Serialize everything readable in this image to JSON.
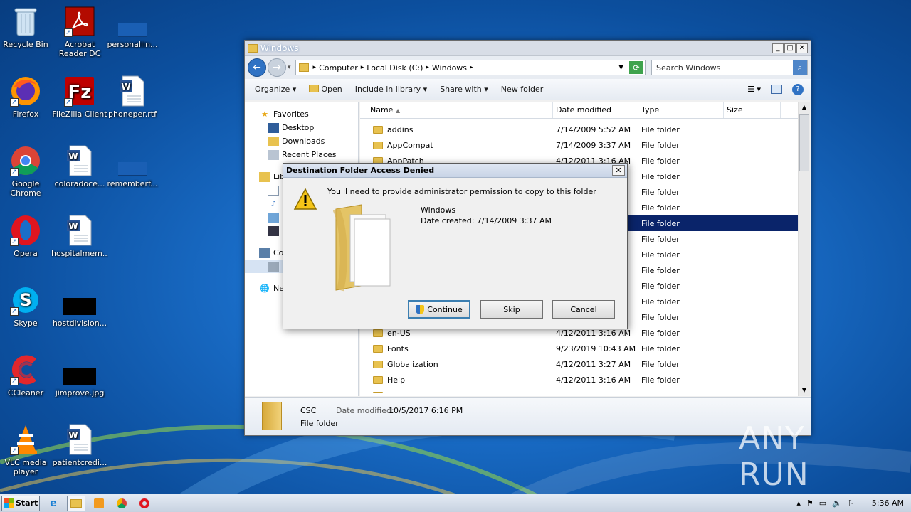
{
  "desktop": {
    "icons": [
      {
        "label": "Recycle Bin"
      },
      {
        "label": "Acrobat\nReader DC"
      },
      {
        "label": "personallin..."
      },
      {
        "label": "Firefox"
      },
      {
        "label": "FileZilla Client"
      },
      {
        "label": "phoneper.rtf"
      },
      {
        "label": "Google\nChrome"
      },
      {
        "label": "coloradoce..."
      },
      {
        "label": "rememberf..."
      },
      {
        "label": "Opera"
      },
      {
        "label": "hospitalmem..."
      },
      {
        "label": "Skype"
      },
      {
        "label": "hostdivision..."
      },
      {
        "label": "CCleaner"
      },
      {
        "label": "jimprove.jpg"
      },
      {
        "label": "VLC media\nplayer"
      },
      {
        "label": "patientcredi..."
      }
    ]
  },
  "explorer": {
    "title": "Windows",
    "address": [
      "Computer",
      "Local Disk (C:)",
      "Windows"
    ],
    "search_placeholder": "Search Windows",
    "toolbar": {
      "organize": "Organize",
      "open": "Open",
      "include": "Include in library",
      "share": "Share with",
      "new_folder": "New folder"
    },
    "nav": {
      "favorites": "Favorites",
      "desktop": "Desktop",
      "downloads": "Downloads",
      "recent": "Recent Places",
      "lib": "Lib",
      "co": "Co",
      "ne": "Ne"
    },
    "columns": {
      "name": "Name",
      "date": "Date modified",
      "type": "Type",
      "size": "Size"
    },
    "rows": [
      {
        "name": "addins",
        "date": "7/14/2009 5:52 AM",
        "type": "File folder"
      },
      {
        "name": "AppCompat",
        "date": "7/14/2009 3:37 AM",
        "type": "File folder"
      },
      {
        "name": "AppPatch",
        "date": "4/12/2011 3:16 AM",
        "type": "File folder"
      },
      {
        "name": "",
        "date": "",
        "type": "File folder"
      },
      {
        "name": "",
        "date": "",
        "type": "File folder"
      },
      {
        "name": "",
        "date": "",
        "type": "File folder"
      },
      {
        "name": "",
        "date": "",
        "type": "File folder"
      },
      {
        "name": "",
        "date": "",
        "type": "File folder"
      },
      {
        "name": "",
        "date": "",
        "type": "File folder"
      },
      {
        "name": "",
        "date": "",
        "type": "File folder"
      },
      {
        "name": "",
        "date": "",
        "type": "File folder"
      },
      {
        "name": "",
        "date": "",
        "type": "File folder"
      },
      {
        "name": "",
        "date": "",
        "type": "File folder"
      },
      {
        "name": "en-US",
        "date": "4/12/2011 3:16 AM",
        "type": "File folder"
      },
      {
        "name": "Fonts",
        "date": "9/23/2019 10:43 AM",
        "type": "File folder"
      },
      {
        "name": "Globalization",
        "date": "4/12/2011 3:27 AM",
        "type": "File folder"
      },
      {
        "name": "Help",
        "date": "4/12/2011 3:16 AM",
        "type": "File folder"
      },
      {
        "name": "IME",
        "date": "4/12/2011 3:16 AM",
        "type": "File folder"
      }
    ],
    "details": {
      "name": "CSC",
      "date_label": "Date modified:",
      "date": "10/5/2017 6:16 PM",
      "type": "File folder"
    }
  },
  "dialog": {
    "title": "Destination Folder Access Denied",
    "message": "You'll need to provide administrator permission to copy to this folder",
    "folder_name": "Windows",
    "date_created": "Date created: 7/14/2009 3:37 AM",
    "continue": "Continue",
    "skip": "Skip",
    "cancel": "Cancel"
  },
  "taskbar": {
    "start": "Start",
    "clock": "5:36 AM"
  },
  "watermark": "ANY RUN"
}
